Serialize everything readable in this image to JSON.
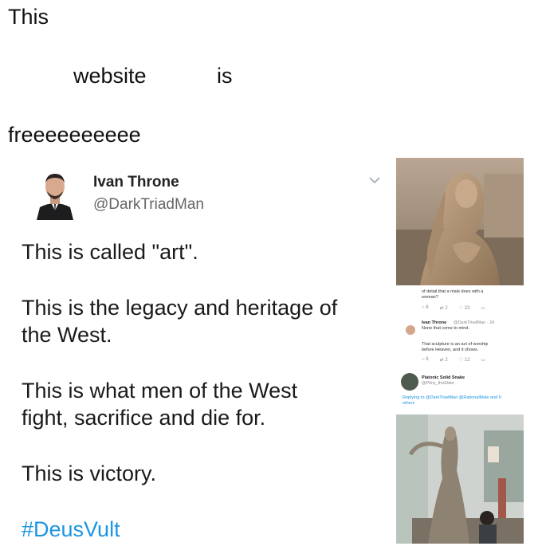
{
  "caption": {
    "word1": "This",
    "word2": "website",
    "word3": "is",
    "word4": "freeeeeeeeee"
  },
  "tweet": {
    "author_name": "Ivan Throne",
    "author_handle": "@DarkTriadMan",
    "lines": [
      "This is called \"art\".",
      "This is the legacy and heritage of",
      "the West.",
      "This is what men of the West",
      "fight, sacrifice and die for.",
      "This is victory."
    ],
    "hashtag": "#DeusVult"
  },
  "replies": {
    "snippet_line1": "of detail that a male does with a",
    "snippet_line2": "woman?",
    "r1_stats": [
      "6",
      "2",
      "23",
      ""
    ],
    "r2_author": "Ivan Throne",
    "r2_meta": "@DarkTriadMan · 2d",
    "r2_text": "None that come to mind.",
    "r2_body1": "That sculpture is an act of worship",
    "r2_body2": "before Heaven, and it shows.",
    "r2_stats": [
      "6",
      "2",
      "12",
      ""
    ],
    "r3_author": "Platonic Solid Snake",
    "r3_handle": "@Pliny_theElder",
    "r3_reply1": "Replying to @DarkTriadMan @RationalMale and 6",
    "r3_reply2": "others"
  },
  "colors": {
    "link": "#1b95e0",
    "muted": "#666666"
  }
}
